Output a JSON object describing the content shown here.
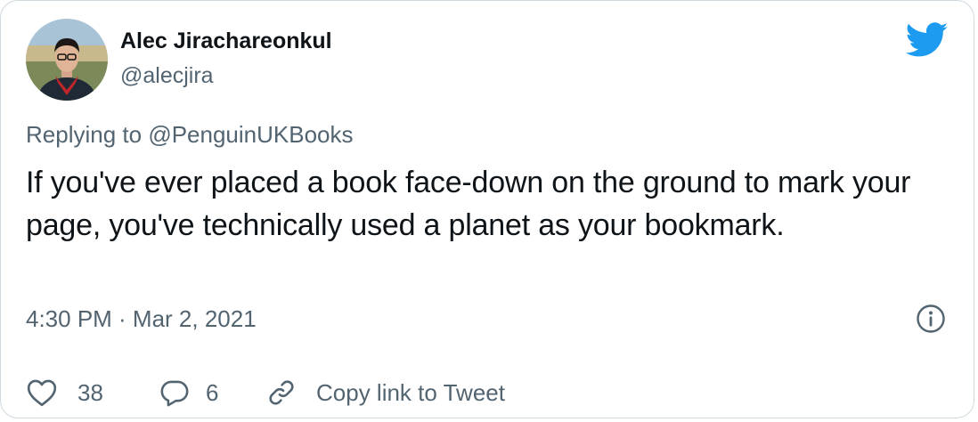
{
  "author": {
    "display_name": "Alec Jirachareonkul",
    "handle": "@alecjira"
  },
  "reply": {
    "prefix": "Replying to",
    "mention": "@PenguinUKBooks"
  },
  "tweet": {
    "text": "If you've ever placed a book face-down on the ground to mark your page, you've technically used a planet as your bookmark.",
    "timestamp": "4:30 PM · Mar 2, 2021"
  },
  "actions": {
    "likes": "38",
    "replies": "6",
    "copy_link": "Copy link to Tweet"
  },
  "icons": {
    "brand": "twitter-bird-icon",
    "info": "info-icon",
    "like": "heart-icon",
    "reply": "speech-bubble-icon",
    "copy": "link-icon"
  },
  "colors": {
    "brand_blue": "#1d9bf0",
    "text_primary": "#0f1419",
    "text_secondary": "#536471",
    "border": "#cfd9de"
  }
}
